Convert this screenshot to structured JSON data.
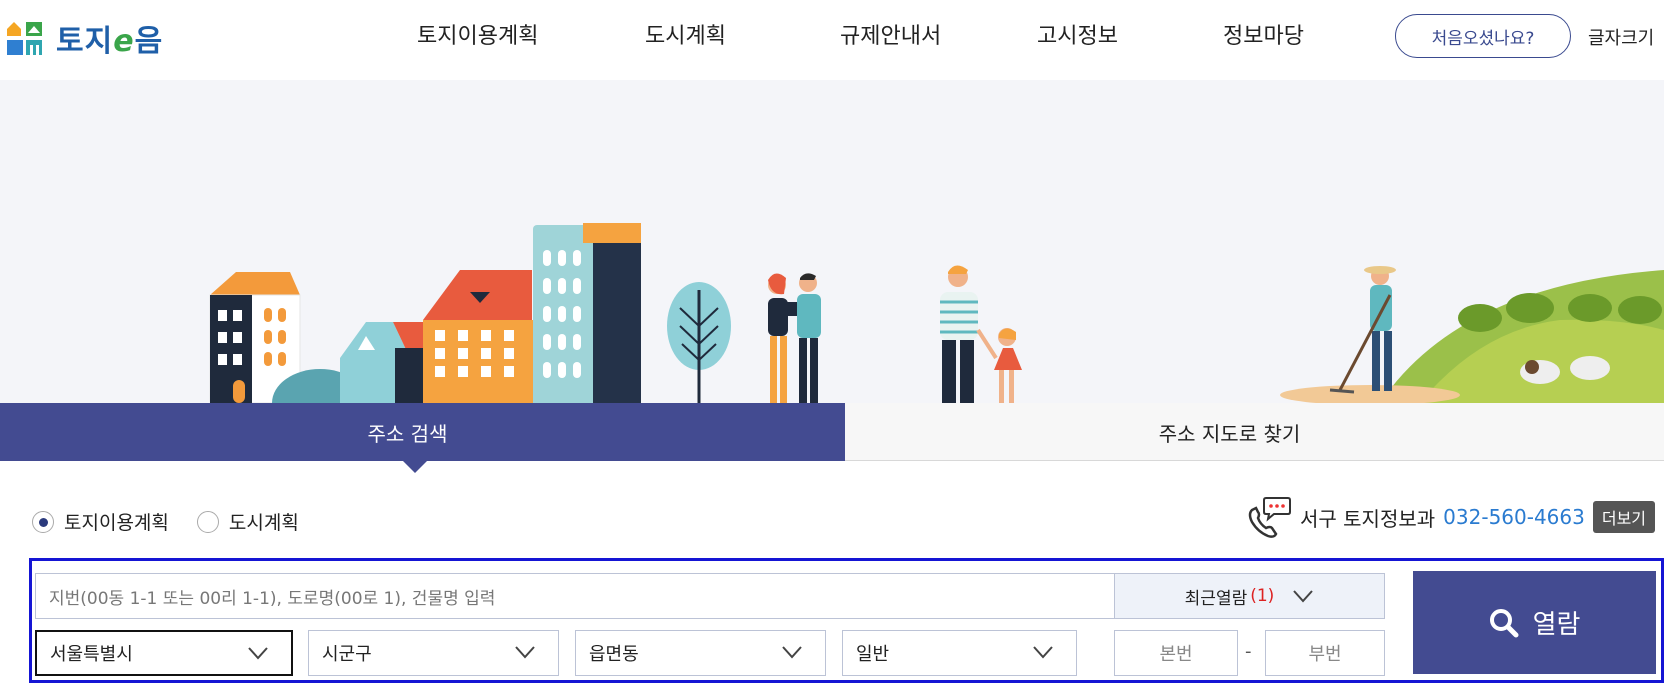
{
  "header": {
    "logo_text_1": "토지",
    "logo_text_e": "e",
    "logo_text_2": "음",
    "nav": [
      "토지이용계획",
      "도시계획",
      "규제안내서",
      "고시정보",
      "정보마당"
    ],
    "first_visit_label": "처음오셨나요?",
    "font_size_label": "글자크기"
  },
  "tabs": {
    "address_search": "주소 검색",
    "map_search": "주소 지도로 찾기"
  },
  "radios": [
    {
      "label": "토지이용계획",
      "selected": true
    },
    {
      "label": "도시계획",
      "selected": false
    }
  ],
  "contact": {
    "office": "서구 토지정보과",
    "phone": "032-560-4663",
    "more_label": "더보기"
  },
  "search": {
    "placeholder": "지번(00동 1-1 또는 00리 1-1), 도로명(00로 1), 건물명 입력",
    "recent_label": "최근열람",
    "recent_count": "(1)",
    "view_label": "열람",
    "sido": "서울특별시",
    "sigungu": "시군구",
    "eupmyeondong": "읍면동",
    "land_type": "일반",
    "main_no": "본번",
    "sub_no": "부번",
    "dash": "-"
  },
  "colors": {
    "primary": "#434b91",
    "link": "#2a7bd0",
    "highlight_border": "#1515d4"
  }
}
